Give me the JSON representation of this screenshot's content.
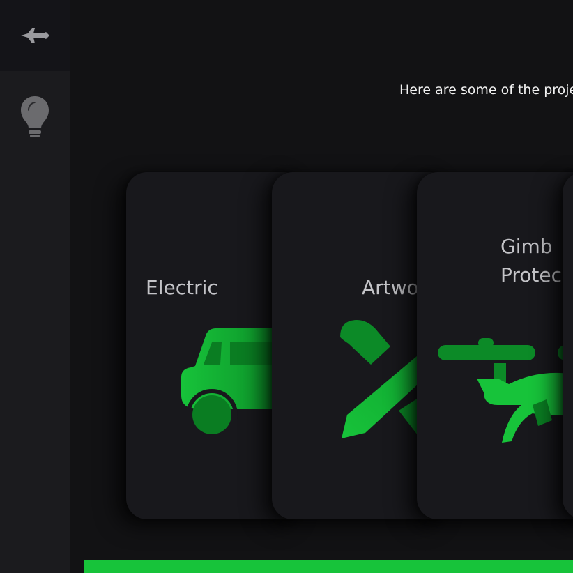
{
  "sidebar": {
    "items": [
      {
        "icon": "jet-icon",
        "active": true
      },
      {
        "icon": "lightbulb-icon",
        "active": false
      }
    ]
  },
  "main": {
    "intro": "Here are some of the proje",
    "projects": [
      {
        "title": "Electric",
        "icon": "car-icon"
      },
      {
        "title": "Artwo",
        "icon": "pencil-ruler-icon"
      },
      {
        "title_line1": "Gimb",
        "title_line2": "Protec",
        "icon": "helicopter-icon"
      },
      {
        "title": "",
        "icon": ""
      }
    ]
  },
  "colors": {
    "accent": "#17c33a",
    "accent_dark": "#0a7d22",
    "sidebar_bg": "#1b1b1e",
    "page_bg": "#121214",
    "card_bg": "#18181c"
  }
}
